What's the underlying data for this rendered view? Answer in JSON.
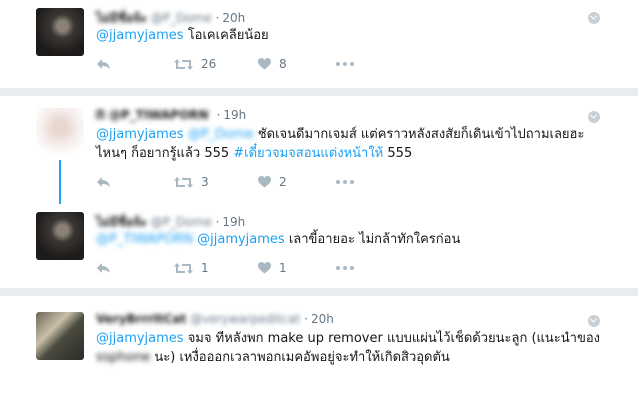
{
  "tweets": [
    {
      "name": "ไม่มีชื่อจ้ะ",
      "handle": "@P_Dome",
      "time": "20h",
      "parts": [
        {
          "t": "@jjamyjames",
          "k": "mention"
        },
        {
          "t": " โอเคเคลียน้อย",
          "k": "text"
        }
      ],
      "retweets": "26",
      "likes": "8"
    },
    {
      "name": "ᗰ @P_TIWAPORN",
      "handle": "",
      "time": "19h",
      "parts": [
        {
          "t": "@jjamyjames",
          "k": "mention"
        },
        {
          "t": " ",
          "k": "text"
        },
        {
          "t": "@P_Dome",
          "k": "mention-blur"
        },
        {
          "t": " ชัดเจนดีมากเจมส์ แต่คราวหลังสงสัยก็เดินเข้าไปถามเลยฮะ",
          "k": "text"
        }
      ],
      "parts2": [
        {
          "t": "ไหนๆ ก็อยากรู้แล้ว 555 ",
          "k": "text"
        },
        {
          "t": "#เดี๋ยวจมจสอนแต่งหน้าให้",
          "k": "hashtag"
        },
        {
          "t": " 555",
          "k": "text"
        }
      ],
      "retweets": "3",
      "likes": "2"
    },
    {
      "name": "ไม่มีชื่อจ้ะ",
      "handle": "@P_Dome",
      "time": "19h",
      "parts": [
        {
          "t": "@P_TIWAPORN",
          "k": "mention-blur"
        },
        {
          "t": " ",
          "k": "text"
        },
        {
          "t": "@jjamyjames",
          "k": "mention"
        },
        {
          "t": " เลาขี้อายอะ ไม่กล้าทักใครก่อน",
          "k": "text"
        }
      ],
      "retweets": "1",
      "likes": "1"
    },
    {
      "name": "VeryBrrrItCat",
      "handle": "@verywarpeditcat",
      "time": "20h",
      "parts": [
        {
          "t": "@jjamyjames",
          "k": "mention"
        },
        {
          "t": " จมจ ทีหลังพก make up remover แบบแผ่นไว้เช็ดด้วยนะลูก (แนะนำของ",
          "k": "text"
        }
      ],
      "parts2": [
        {
          "t": "ssphone",
          "k": "text-blur"
        },
        {
          "t": " นะ) เหงื่อออกเวลาพอกเมคอัพอยู่จะทำให้เกิดสิวอุดตัน",
          "k": "text"
        }
      ],
      "retweets": "",
      "likes": ""
    }
  ],
  "separator": "·",
  "icons": {
    "reply": "reply-icon",
    "retweet": "retweet-icon",
    "like": "heart-icon",
    "more": "more-icon",
    "caret": "caret-down-icon"
  },
  "colors": {
    "link": "#1da1f2",
    "meta": "#657786",
    "icon": "#aab8c2",
    "background": "#e6ecf0"
  }
}
